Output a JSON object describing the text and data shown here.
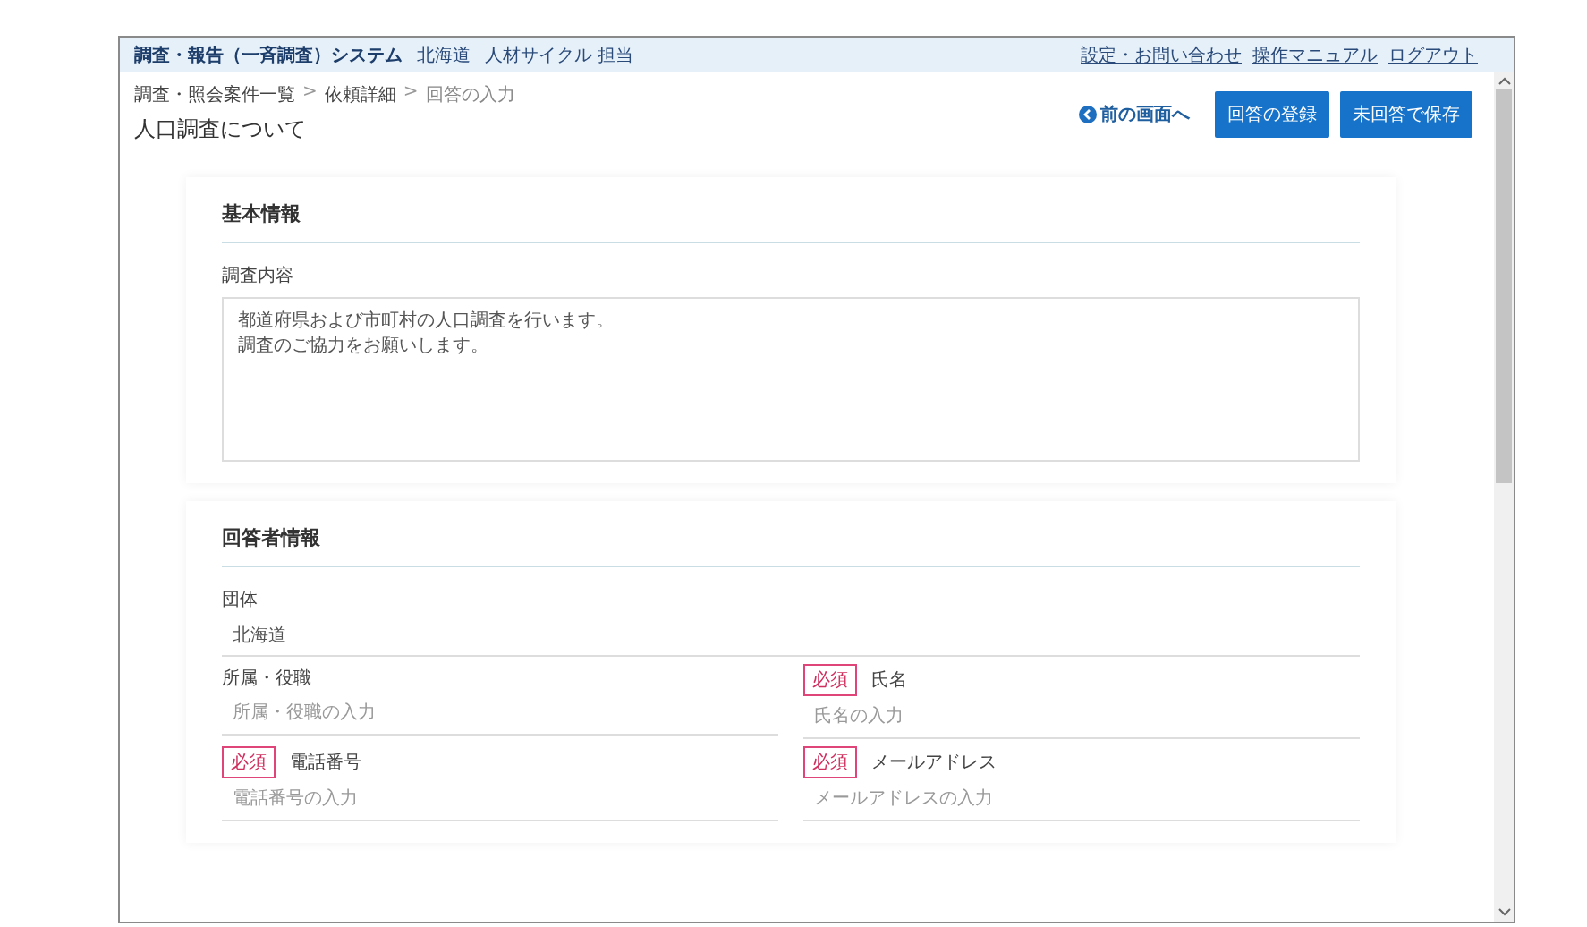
{
  "header": {
    "system_title": "調査・報告（一斉調査）システム",
    "org": "北海道",
    "user": "人材サイクル 担当",
    "links": [
      "設定・お問い合わせ",
      "操作マニュアル",
      "ログアウト"
    ]
  },
  "breadcrumb": [
    {
      "kind": "link",
      "text": "調査・照会案件一覧"
    },
    {
      "kind": "separator",
      "text": ">"
    },
    {
      "kind": "link",
      "text": "依頼詳細"
    },
    {
      "kind": "separator",
      "text": ">"
    },
    {
      "kind": "current",
      "text": "回答の入力"
    }
  ],
  "page_title": "人口調査について",
  "back_link": "前の画面へ",
  "buttons": [
    "回答の登録",
    "未回答で保存"
  ],
  "sections": [
    {
      "title": "基本情報",
      "rows": [
        [
          {
            "kind": "textarea",
            "label": "調査内容",
            "required": false,
            "lines": [
              "都道府県および市町村の人口調査を行います。",
              "調査のご協力をお願いします。"
            ]
          }
        ]
      ]
    },
    {
      "title": "回答者情報",
      "rows": [
        [
          {
            "kind": "text",
            "label": "団体",
            "required": false,
            "value": "北海道"
          }
        ],
        [
          {
            "kind": "text",
            "label": "所属・役職",
            "required": false,
            "placeholder": "所属・役職の入力"
          },
          {
            "kind": "text",
            "label": "氏名",
            "required": true,
            "required_label": "必須",
            "placeholder": "氏名の入力"
          }
        ],
        [
          {
            "kind": "text",
            "label": "電話番号",
            "required": true,
            "required_label": "必須",
            "placeholder": "電話番号の入力"
          },
          {
            "kind": "text",
            "label": "メールアドレス",
            "required": true,
            "required_label": "必須",
            "placeholder": "メールアドレスの入力"
          }
        ]
      ]
    }
  ]
}
